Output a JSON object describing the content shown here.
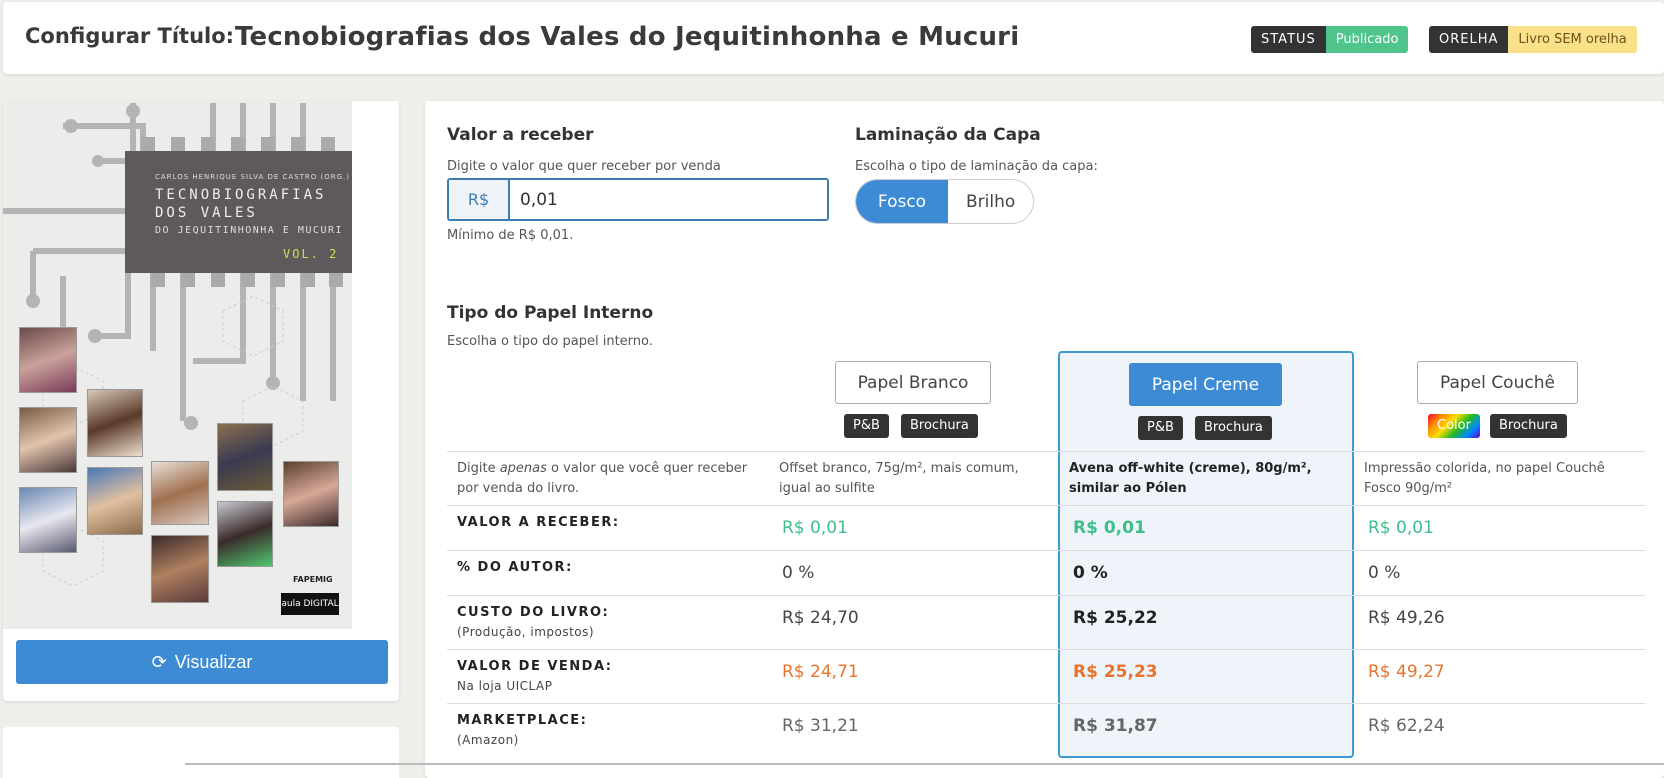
{
  "header": {
    "label": "Configurar Título:",
    "title": "Tecnobiografias dos Vales do Jequitinhonha e Mucuri",
    "status_key": "STATUS",
    "status_value": "Publicado",
    "orelha_key": "ORELHA",
    "orelha_value": "Livro SEM orelha"
  },
  "cover": {
    "author": "CARLOS HENRIQUE SILVA DE CASTRO (ORG.)",
    "title_line1": "TECNOBIOGRAFIAS",
    "title_line2": "DOS VALES",
    "title_line3": "DO JEQUITINHONHA E MUCURI",
    "volume": "VOL. 2",
    "publisher1": "FAPEMIG",
    "publisher2": "aula DIGITAL",
    "visualize_label": "Visualizar"
  },
  "valor": {
    "heading": "Valor a receber",
    "hint": "Digite o valor que quer receber por venda",
    "prefix": "R$",
    "value": "0,01",
    "min_note": "Mínimo de R$ 0,01."
  },
  "laminacao": {
    "heading": "Laminação da Capa",
    "hint": "Escolha o tipo de laminação da capa:",
    "options": [
      "Fosco",
      "Brilho"
    ],
    "selected": "Fosco"
  },
  "papel": {
    "heading": "Tipo do Papel Interno",
    "hint": "Escolha o tipo do papel interno.",
    "intro_pre": "Digite ",
    "intro_em": "apenas",
    "intro_post": " o valor que você quer receber por venda do livro.",
    "options": [
      {
        "label": "Papel Branco",
        "tags": [
          "P&B",
          "Brochura"
        ],
        "desc": "Offset branco, 75g/m², mais comum, igual ao sulfite"
      },
      {
        "label": "Papel Creme",
        "tags": [
          "P&B",
          "Brochura"
        ],
        "desc": "Avena off-white (creme), 80g/m², similar ao Pólen"
      },
      {
        "label": "Papel Couchê",
        "tags": [
          "Color",
          "Brochura"
        ],
        "desc": "Impressão colorida, no papel Couchê Fosco 90g/m²"
      }
    ],
    "selected": "Papel Creme"
  },
  "rows": [
    {
      "label": "VALOR A RECEBER:",
      "sub": "",
      "values": [
        "R$ 0,01",
        "R$ 0,01",
        "R$ 0,01"
      ],
      "color": "#3fbe8a"
    },
    {
      "label": "% DO AUTOR:",
      "sub": "",
      "values": [
        "0 %",
        "0 %",
        "0 %"
      ],
      "color": "#444444"
    },
    {
      "label": "CUSTO DO LIVRO:",
      "sub": "(Produção, impostos)",
      "values": [
        "R$ 24,70",
        "R$ 25,22",
        "R$ 49,26"
      ],
      "color": "#444444"
    },
    {
      "label": "VALOR DE VENDA:",
      "sub": "Na loja UICLAP",
      "values": [
        "R$ 24,71",
        "R$ 25,23",
        "R$ 49,27"
      ],
      "color": "#e8732e"
    },
    {
      "label": "MARKETPLACE:",
      "sub": "(Amazon)",
      "values": [
        "R$ 31,21",
        "R$ 31,87",
        "R$ 62,24"
      ],
      "color": "#666666"
    }
  ]
}
